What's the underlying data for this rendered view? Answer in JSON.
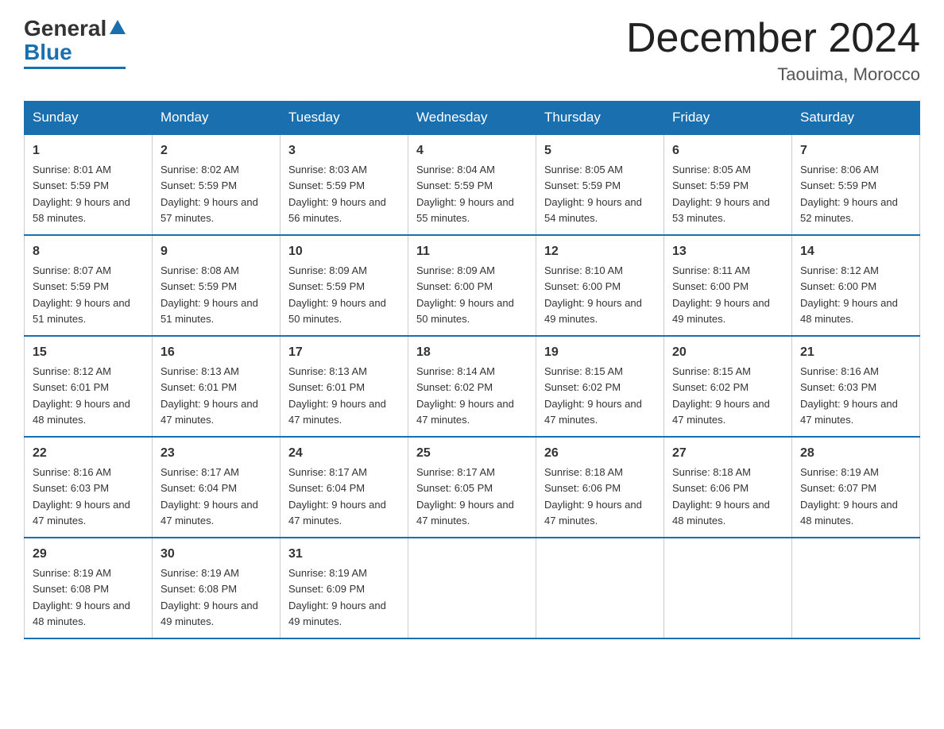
{
  "header": {
    "logo": {
      "general": "General",
      "blue": "Blue"
    },
    "title": "December 2024",
    "location": "Taouima, Morocco"
  },
  "days_of_week": [
    "Sunday",
    "Monday",
    "Tuesday",
    "Wednesday",
    "Thursday",
    "Friday",
    "Saturday"
  ],
  "weeks": [
    [
      {
        "day": "1",
        "sunrise": "8:01 AM",
        "sunset": "5:59 PM",
        "daylight": "9 hours and 58 minutes."
      },
      {
        "day": "2",
        "sunrise": "8:02 AM",
        "sunset": "5:59 PM",
        "daylight": "9 hours and 57 minutes."
      },
      {
        "day": "3",
        "sunrise": "8:03 AM",
        "sunset": "5:59 PM",
        "daylight": "9 hours and 56 minutes."
      },
      {
        "day": "4",
        "sunrise": "8:04 AM",
        "sunset": "5:59 PM",
        "daylight": "9 hours and 55 minutes."
      },
      {
        "day": "5",
        "sunrise": "8:05 AM",
        "sunset": "5:59 PM",
        "daylight": "9 hours and 54 minutes."
      },
      {
        "day": "6",
        "sunrise": "8:05 AM",
        "sunset": "5:59 PM",
        "daylight": "9 hours and 53 minutes."
      },
      {
        "day": "7",
        "sunrise": "8:06 AM",
        "sunset": "5:59 PM",
        "daylight": "9 hours and 52 minutes."
      }
    ],
    [
      {
        "day": "8",
        "sunrise": "8:07 AM",
        "sunset": "5:59 PM",
        "daylight": "9 hours and 51 minutes."
      },
      {
        "day": "9",
        "sunrise": "8:08 AM",
        "sunset": "5:59 PM",
        "daylight": "9 hours and 51 minutes."
      },
      {
        "day": "10",
        "sunrise": "8:09 AM",
        "sunset": "5:59 PM",
        "daylight": "9 hours and 50 minutes."
      },
      {
        "day": "11",
        "sunrise": "8:09 AM",
        "sunset": "6:00 PM",
        "daylight": "9 hours and 50 minutes."
      },
      {
        "day": "12",
        "sunrise": "8:10 AM",
        "sunset": "6:00 PM",
        "daylight": "9 hours and 49 minutes."
      },
      {
        "day": "13",
        "sunrise": "8:11 AM",
        "sunset": "6:00 PM",
        "daylight": "9 hours and 49 minutes."
      },
      {
        "day": "14",
        "sunrise": "8:12 AM",
        "sunset": "6:00 PM",
        "daylight": "9 hours and 48 minutes."
      }
    ],
    [
      {
        "day": "15",
        "sunrise": "8:12 AM",
        "sunset": "6:01 PM",
        "daylight": "9 hours and 48 minutes."
      },
      {
        "day": "16",
        "sunrise": "8:13 AM",
        "sunset": "6:01 PM",
        "daylight": "9 hours and 47 minutes."
      },
      {
        "day": "17",
        "sunrise": "8:13 AM",
        "sunset": "6:01 PM",
        "daylight": "9 hours and 47 minutes."
      },
      {
        "day": "18",
        "sunrise": "8:14 AM",
        "sunset": "6:02 PM",
        "daylight": "9 hours and 47 minutes."
      },
      {
        "day": "19",
        "sunrise": "8:15 AM",
        "sunset": "6:02 PM",
        "daylight": "9 hours and 47 minutes."
      },
      {
        "day": "20",
        "sunrise": "8:15 AM",
        "sunset": "6:02 PM",
        "daylight": "9 hours and 47 minutes."
      },
      {
        "day": "21",
        "sunrise": "8:16 AM",
        "sunset": "6:03 PM",
        "daylight": "9 hours and 47 minutes."
      }
    ],
    [
      {
        "day": "22",
        "sunrise": "8:16 AM",
        "sunset": "6:03 PM",
        "daylight": "9 hours and 47 minutes."
      },
      {
        "day": "23",
        "sunrise": "8:17 AM",
        "sunset": "6:04 PM",
        "daylight": "9 hours and 47 minutes."
      },
      {
        "day": "24",
        "sunrise": "8:17 AM",
        "sunset": "6:04 PM",
        "daylight": "9 hours and 47 minutes."
      },
      {
        "day": "25",
        "sunrise": "8:17 AM",
        "sunset": "6:05 PM",
        "daylight": "9 hours and 47 minutes."
      },
      {
        "day": "26",
        "sunrise": "8:18 AM",
        "sunset": "6:06 PM",
        "daylight": "9 hours and 47 minutes."
      },
      {
        "day": "27",
        "sunrise": "8:18 AM",
        "sunset": "6:06 PM",
        "daylight": "9 hours and 48 minutes."
      },
      {
        "day": "28",
        "sunrise": "8:19 AM",
        "sunset": "6:07 PM",
        "daylight": "9 hours and 48 minutes."
      }
    ],
    [
      {
        "day": "29",
        "sunrise": "8:19 AM",
        "sunset": "6:08 PM",
        "daylight": "9 hours and 48 minutes."
      },
      {
        "day": "30",
        "sunrise": "8:19 AM",
        "sunset": "6:08 PM",
        "daylight": "9 hours and 49 minutes."
      },
      {
        "day": "31",
        "sunrise": "8:19 AM",
        "sunset": "6:09 PM",
        "daylight": "9 hours and 49 minutes."
      },
      null,
      null,
      null,
      null
    ]
  ]
}
